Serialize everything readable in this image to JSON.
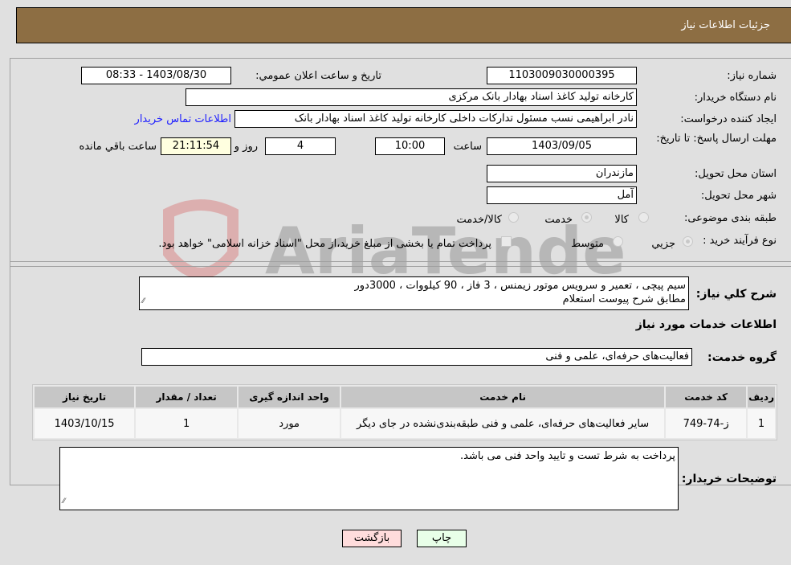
{
  "header": {
    "title": "جزئیات اطلاعات نیاز"
  },
  "form": {
    "need_number_label": "شماره نیاز:",
    "need_number": "1103009030000395",
    "announce_label": "تاریخ و ساعت اعلان عمومي:",
    "announce_value": "1403/08/30 - 08:33",
    "buyer_org_label": "نام دستگاه خریدار:",
    "buyer_org": "کارخانه تولید کاغذ اسناد بهادار بانک مرکزی",
    "creator_label": "ایجاد کننده درخواست:",
    "creator": "نادر ابراهیمی نسب مسئول تدارکات داخلی کارخانه تولید کاغذ اسناد بهادار بانک",
    "contact_link": "اطلاعات تماس خریدار",
    "deadline_label": "مهلت ارسال پاسخ: تا تاریخ:",
    "deadline_date": "1403/09/05",
    "time_label": "ساعت",
    "deadline_time": "10:00",
    "days_value": "4",
    "days_label": "روز و",
    "remaining_time": "21:11:54",
    "remaining_label": "ساعت باقي مانده",
    "province_label": "استان محل تحویل:",
    "province": "مازندران",
    "city_label": "شهر محل تحویل:",
    "city": "آمل",
    "category_label": "طبقه بندی موضوعی:",
    "category_options": [
      "کالا",
      "خدمت",
      "کالا/خدمت"
    ],
    "category_selected": "خدمت",
    "process_label": "نوع فرآیند خرید :",
    "process_options": [
      "جزيي",
      "متوسط"
    ],
    "process_selected": "جزيي",
    "treasury_note": "پرداخت تمام یا بخشی از مبلغ خرید،از محل \"اسناد خزانه اسلامی\" خواهد بود.",
    "description_label": "شرح کلي نیاز:",
    "description_line1": "سیم پیچی ، تعمیر و سرویس موتور زیمنس ، 3 فاز ، 90 کیلووات ، 3000دور",
    "description_line2": "مطابق شرح پیوست استعلام",
    "services_heading": "اطلاعات خدمات مورد نیاز",
    "service_group_label": "گروه خدمت:",
    "service_group": "فعالیت‌های حرفه‌ای، علمی و فنی"
  },
  "table": {
    "headers": [
      "ردیف",
      "کد خدمت",
      "نام خدمت",
      "واحد اندازه گیری",
      "تعداد / مقدار",
      "تاریخ نیاز"
    ],
    "rows": [
      [
        "1",
        "ز-74-749",
        "سایر فعالیت‌های حرفه‌ای، علمی و فنی طبقه‌بندی‌نشده در جای دیگر",
        "مورد",
        "1",
        "1403/10/15"
      ]
    ]
  },
  "buyer_notes_label": "توضیحات خریدار:",
  "buyer_notes": "پرداخت به شرط تست و تایید واحد فنی می باشد.",
  "buttons": {
    "print": "چاپ",
    "back": "بازگشت"
  },
  "watermark": "AriaTender.neT",
  "colors": {
    "header_bg": "#8d6e43",
    "print_btn": "#e8ffe8",
    "back_btn": "#ffdcdc",
    "link": "#2020ff"
  }
}
